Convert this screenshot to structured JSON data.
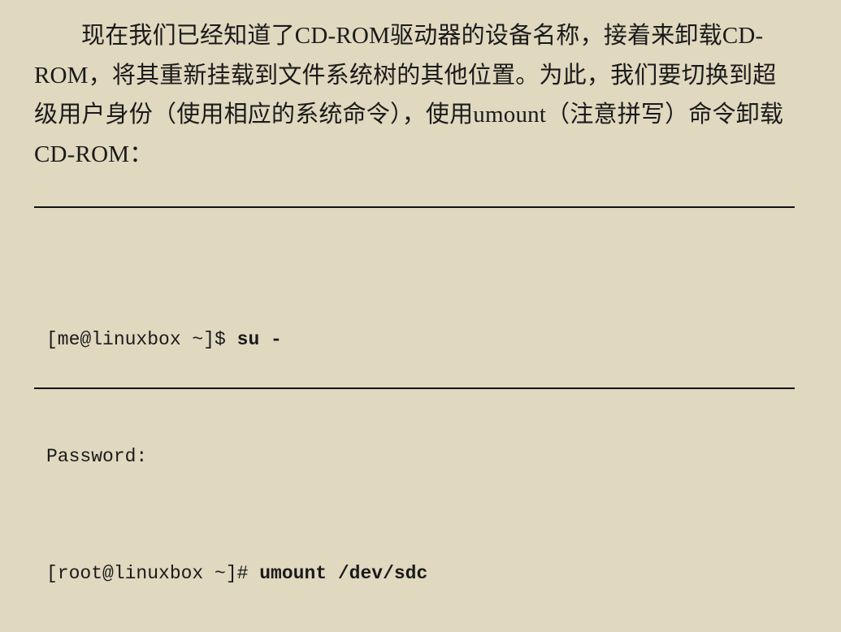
{
  "paragraph": {
    "text": "现在我们已经知道了CD-ROM驱动器的设备名称，接着来卸载CD-ROM，将其重新挂载到文件系统树的其他位置。为此，我们要切换到超级用户身份（使用相应的系统命令），使用umount（注意拼写）命令卸载CD-ROM："
  },
  "terminal": {
    "lines": [
      {
        "prompt": "[me@linuxbox ~]$ ",
        "command": "su -"
      },
      {
        "prompt": "Password:",
        "command": ""
      },
      {
        "prompt": "[root@linuxbox ~]# ",
        "command": "umount /dev/sdc"
      }
    ]
  }
}
